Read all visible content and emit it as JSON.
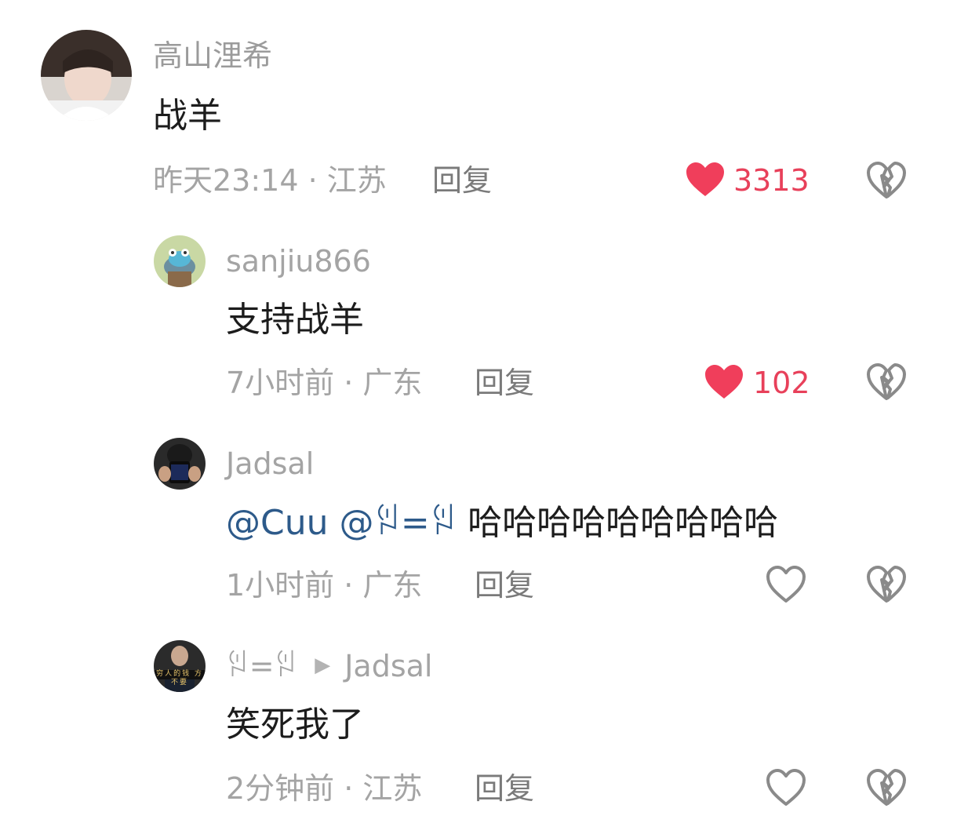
{
  "comments": [
    {
      "user": "高山浬希",
      "text": "战羊",
      "meta": "昨天23:14 · 江苏",
      "reply_label": "回复",
      "likes": "3313",
      "liked": true
    },
    {
      "user": "sanjiu866",
      "text": "支持战羊",
      "meta": "7小时前 · 广东",
      "reply_label": "回复",
      "likes": "102",
      "liked": true
    },
    {
      "user": "Jadsal",
      "mention1": "@Cuu",
      "mention2": "@ꇌ=ꇌ",
      "text": "哈哈哈哈哈哈哈哈哈",
      "meta": "1小时前 · 广东",
      "reply_label": "回复",
      "liked": false
    },
    {
      "user": "ꇌ=ꇌ",
      "reply_to": "Jadsal",
      "text": "笑死我了",
      "meta": "2分钟前 · 江苏",
      "reply_label": "回复",
      "liked": false,
      "avatar_text": "穷人的钱 方不要"
    }
  ],
  "icons": {
    "like": "heart-icon",
    "dislike": "broken-heart-icon",
    "reply_arrow": "play-triangle-icon"
  },
  "colors": {
    "like_active": "#f03e5b",
    "mention": "#2d5a8a",
    "meta": "#a4a4a4"
  }
}
